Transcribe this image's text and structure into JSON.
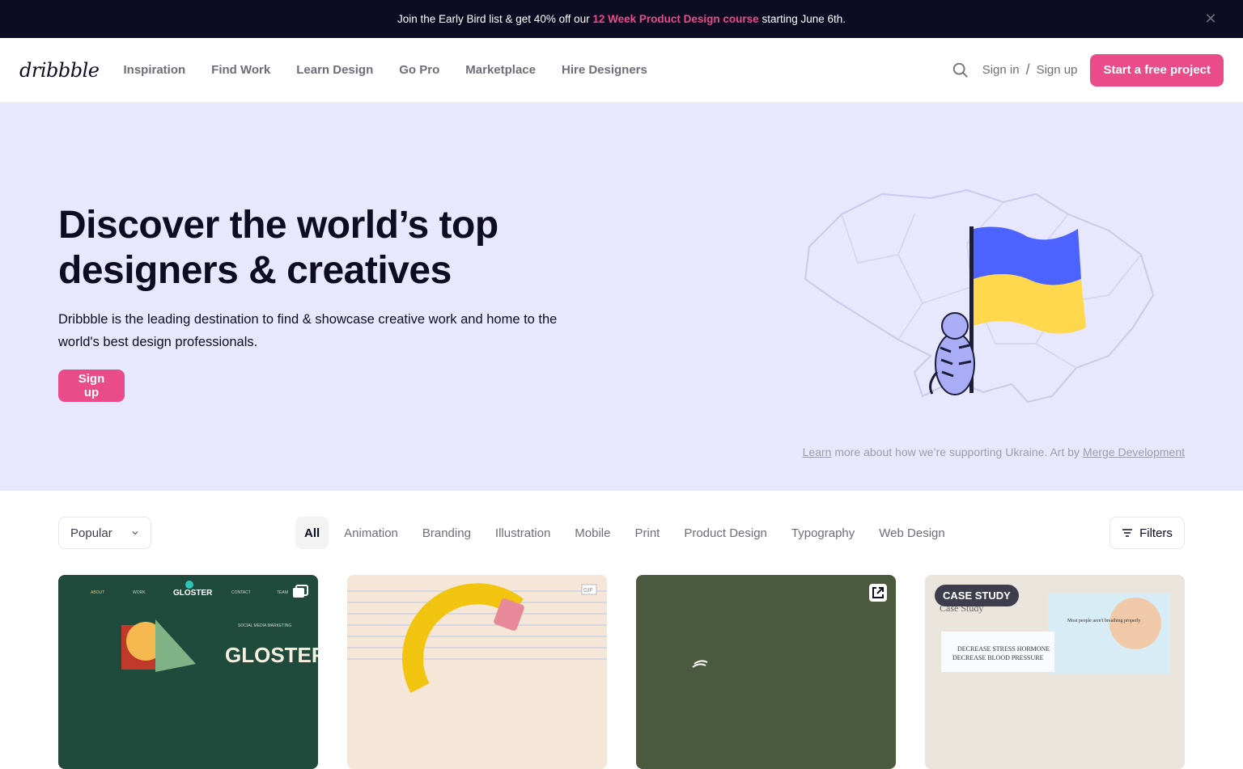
{
  "banner": {
    "text_before": "Join the Early Bird list & get 40% off our ",
    "highlight": "12 Week Product Design course",
    "text_after": " starting June 6th.",
    "close": "✕"
  },
  "header": {
    "logo": "dribbble",
    "nav": [
      "Inspiration",
      "Find Work",
      "Learn Design",
      "Go Pro",
      "Marketplace",
      "Hire Designers"
    ],
    "sign_in": "Sign in",
    "separator": "/",
    "sign_up": "Sign up",
    "cta": "Start a free project"
  },
  "hero": {
    "title_line1": "Discover the world’s top",
    "title_line2": "designers & creatives",
    "subtitle": "Dribbble is the leading destination to find & showcase creative work and home to the world's best design professionals.",
    "button": "Sign up",
    "credit_learn": "Learn",
    "credit_middle": " more about how we’re supporting Ukraine. Art by ",
    "credit_author": "Merge Development"
  },
  "filter": {
    "sort": "Popular",
    "categories": [
      "All",
      "Animation",
      "Branding",
      "Illustration",
      "Mobile",
      "Print",
      "Product Design",
      "Typography",
      "Web Design"
    ],
    "filters_label": "Filters"
  },
  "shots": {
    "s1_title": "GLOSTER",
    "s1_nav": [
      "ABOUT",
      "WORK",
      "GLOSTER",
      "CONTACT",
      "TEAM"
    ],
    "s1_sub": "SOCIAL MEDIA MARKETING",
    "s2_badge": "GIF",
    "case_study": "CASE STUDY",
    "s4_lines": [
      "Case Study",
      "Most people aren't breathing properly",
      "DECREASE STRESS HORMONE",
      "DECREASE BLOOD PRESSURE"
    ]
  },
  "colors": {
    "accent": "#ea4c89",
    "banner_bg": "#0d0c22",
    "hero_bg": "#e7e7fd"
  }
}
